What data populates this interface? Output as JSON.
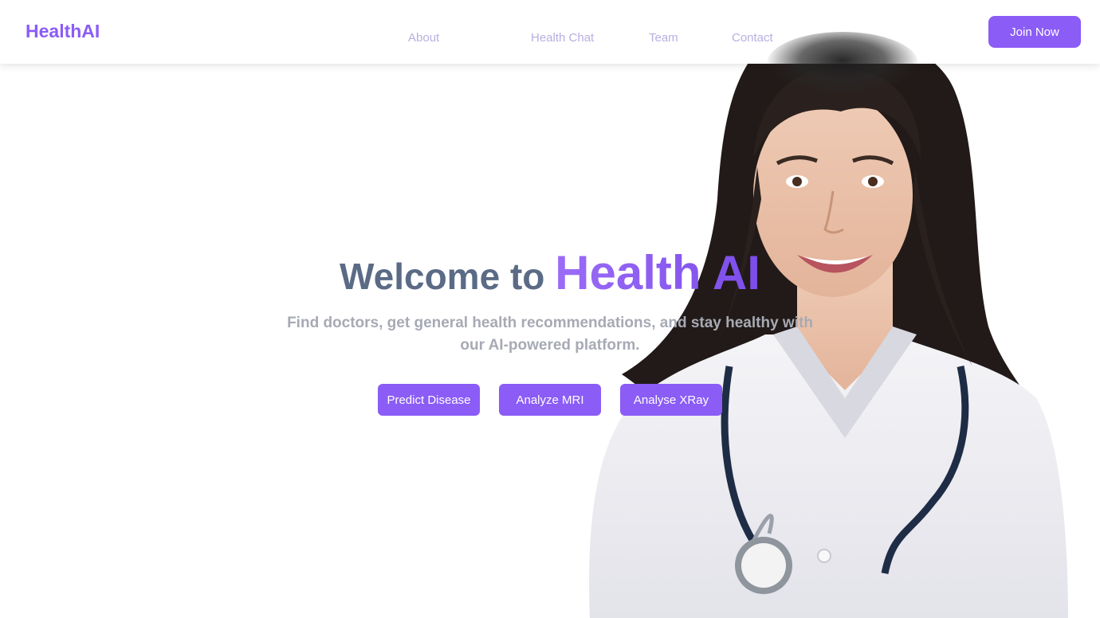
{
  "header": {
    "logo": "HealthAI",
    "nav": [
      "About",
      "Health Chat",
      "Team",
      "Contact"
    ],
    "cta": "Join Now"
  },
  "hero": {
    "title_prefix": "Welcome to",
    "title_accent": "Health AI",
    "subtitle": "Find doctors, get general health recommendations, and stay healthy with our AI-powered platform.",
    "buttons": [
      "Predict Disease",
      "Analyze MRI",
      "Analyse XRay"
    ]
  },
  "colors": {
    "brand": "#8b5cf6",
    "nav_text": "#b9aee0",
    "heading": "#5b6b86",
    "subtitle": "#a7aab4"
  },
  "icons": [
    "doctor-illustration"
  ]
}
